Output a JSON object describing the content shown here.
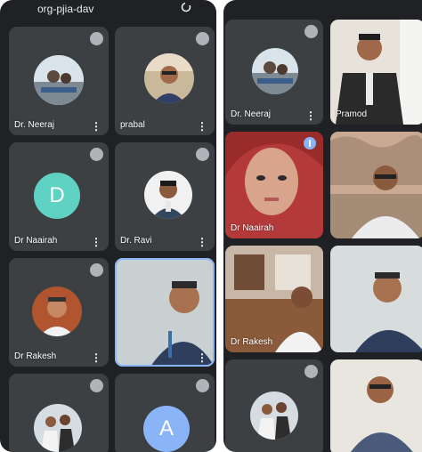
{
  "left_screen": {
    "header": {
      "title": "org-pjia-dav"
    },
    "tiles": [
      {
        "name": "Dr. Neeraj",
        "avatar": "photo"
      },
      {
        "name": "prabal",
        "avatar": "photo"
      },
      {
        "name": "Dr Naairah",
        "avatar_letter": "D",
        "avatar_color": "#5fd2c3"
      },
      {
        "name": "Dr. Ravi",
        "avatar": "photo"
      },
      {
        "name": "Dr Rakesh",
        "avatar": "photo"
      },
      {
        "name": "",
        "avatar": "video"
      },
      {
        "name": "",
        "avatar": "photo"
      },
      {
        "name": "",
        "avatar_letter": "A",
        "avatar_color": "#8ab4f8"
      }
    ]
  },
  "right_screen": {
    "tiles": [
      {
        "name": "Dr. Neeraj",
        "avatar": "photo"
      },
      {
        "name": "Pramod",
        "avatar": "video"
      },
      {
        "name": "Dr Naairah",
        "avatar": "video"
      },
      {
        "name": "",
        "avatar": "video"
      },
      {
        "name": "Dr Rakesh",
        "avatar": "video"
      },
      {
        "name": "",
        "avatar": "video"
      },
      {
        "name": "",
        "avatar": "photo"
      },
      {
        "name": "",
        "avatar": "video"
      }
    ]
  },
  "menu_glyph": "⋮",
  "colors": {
    "background": "#202124",
    "tile": "#3c4043",
    "active_outline": "#8ab4f8"
  }
}
